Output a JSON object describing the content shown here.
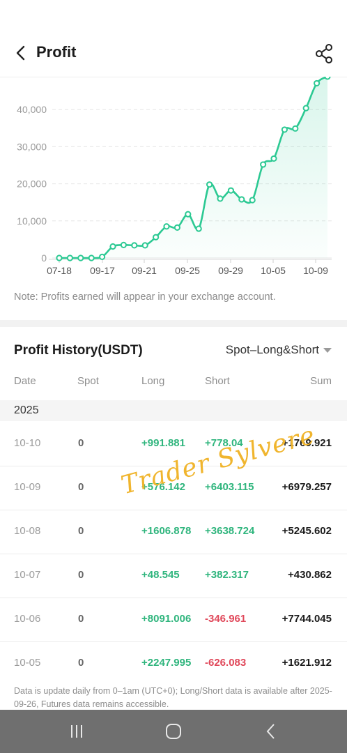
{
  "header": {
    "title": "Profit",
    "back_icon": "chevron-left-icon",
    "share_icon": "share-icon"
  },
  "chart_data": {
    "type": "area",
    "x_ticks": [
      "07-18",
      "09-17",
      "09-21",
      "09-25",
      "09-29",
      "10-05",
      "10-09"
    ],
    "y_ticks": [
      "0",
      "10,000",
      "20,000",
      "30,000",
      "40,000"
    ],
    "ylim": [
      0,
      50000
    ],
    "x_index": [
      0,
      1,
      2,
      3,
      4,
      5,
      6,
      7,
      8,
      9,
      10,
      11,
      12,
      13,
      14,
      15,
      16,
      17,
      18,
      19,
      20,
      21,
      22,
      23,
      24,
      25
    ],
    "values": [
      0,
      0,
      0,
      0,
      300,
      3100,
      3500,
      3400,
      3400,
      5600,
      8500,
      8200,
      11800,
      7900,
      19800,
      16000,
      18200,
      15800,
      15600,
      25200,
      26800,
      34600,
      34900,
      40400,
      47100,
      48900
    ],
    "grid": true,
    "line_color": "#2cc993"
  },
  "note": "Note: Profits earned will appear in your exchange account.",
  "history": {
    "title": "Profit History(USDT)",
    "filter": "Spot–Long&Short",
    "columns": {
      "date": "Date",
      "spot": "Spot",
      "long": "Long",
      "short": "Short",
      "sum": "Sum"
    },
    "year": "2025",
    "rows": [
      {
        "date": "10-10",
        "spot": "0",
        "long": "+991.881",
        "short": "+778.04",
        "sum": "+1769.921"
      },
      {
        "date": "10-09",
        "spot": "0",
        "long": "+576.142",
        "short": "+6403.115",
        "sum": "+6979.257"
      },
      {
        "date": "10-08",
        "spot": "0",
        "long": "+1606.878",
        "short": "+3638.724",
        "sum": "+5245.602"
      },
      {
        "date": "10-07",
        "spot": "0",
        "long": "+48.545",
        "short": "+382.317",
        "sum": "+430.862"
      },
      {
        "date": "10-06",
        "spot": "0",
        "long": "+8091.006",
        "short": "-346.961",
        "sum": "+7744.045"
      },
      {
        "date": "10-05",
        "spot": "0",
        "long": "+2247.995",
        "short": "-626.083",
        "sum": "+1621.912"
      }
    ]
  },
  "footnote": "Data is update daily from 0–1am (UTC+0); Long/Short data is available after 2025-09-26, Futures data remains accessible.",
  "watermark": "Trader Sylvere",
  "navbar": {
    "recents_icon": "recents-icon",
    "home_icon": "home-icon",
    "back_icon": "nav-back-icon"
  },
  "colors": {
    "positive": "#2fb57d",
    "negative": "#e0485a",
    "accent": "#2cc993"
  }
}
